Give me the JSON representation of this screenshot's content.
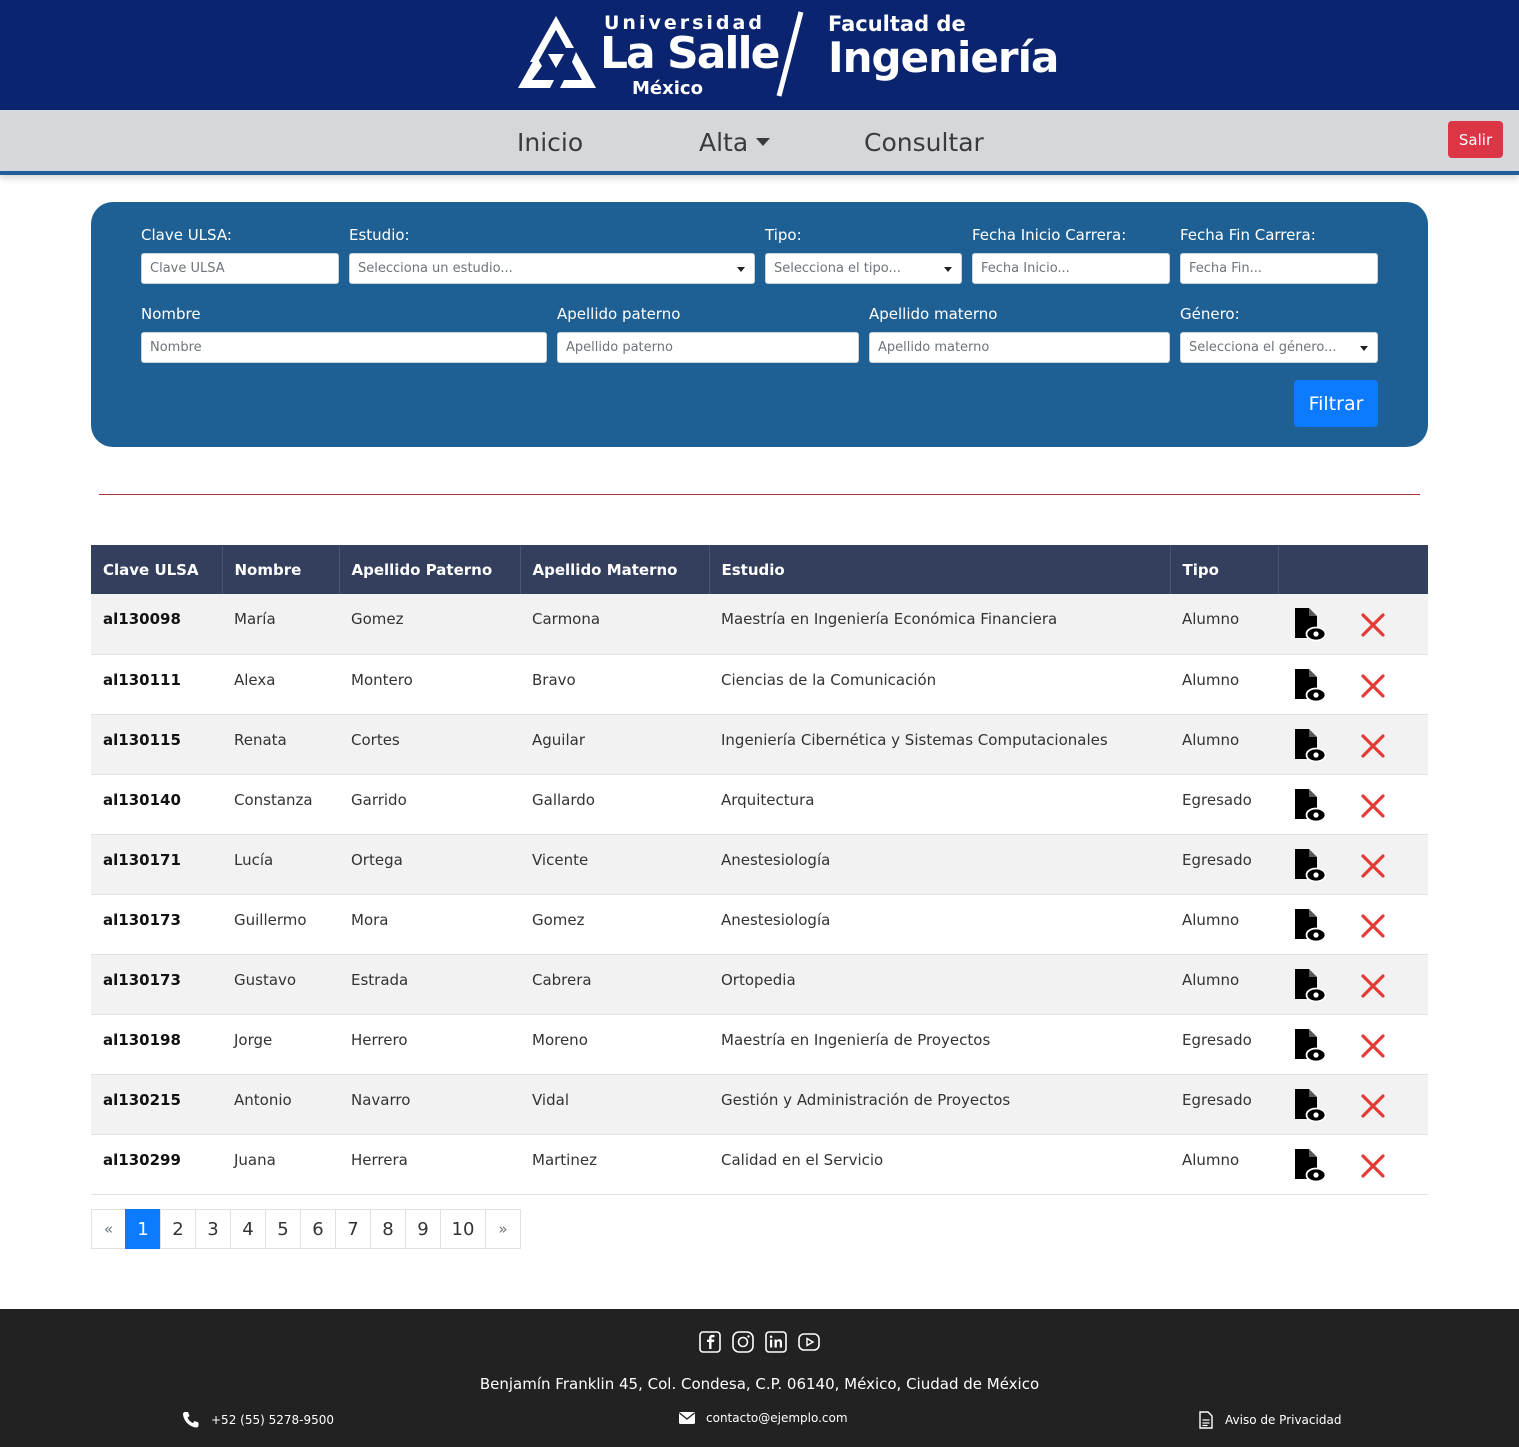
{
  "header": {
    "universidad": "Universidad",
    "lasalle": "La Salle",
    "mexico": "México",
    "facultad": "Facultad de",
    "ingenieria": "Ingeniería"
  },
  "nav": {
    "inicio": "Inicio",
    "alta": "Alta",
    "consultar": "Consultar",
    "salir": "Salir"
  },
  "filters": {
    "clave": {
      "label": "Clave ULSA:",
      "placeholder": "Clave ULSA"
    },
    "estudio": {
      "label": "Estudio:",
      "placeholder": "Selecciona un estudio..."
    },
    "tipo": {
      "label": "Tipo:",
      "placeholder": "Selecciona el tipo..."
    },
    "fecha_inicio": {
      "label": "Fecha Inicio Carrera:",
      "placeholder": "Fecha Inicio..."
    },
    "fecha_fin": {
      "label": "Fecha Fin Carrera:",
      "placeholder": "Fecha Fin..."
    },
    "nombre": {
      "label": "Nombre",
      "placeholder": "Nombre"
    },
    "apellido_paterno": {
      "label": "Apellido paterno",
      "placeholder": "Apellido paterno"
    },
    "apellido_materno": {
      "label": "Apellido materno",
      "placeholder": "Apellido materno"
    },
    "genero": {
      "label": "Género:",
      "placeholder": "Selecciona el género..."
    },
    "filtrar": "Filtrar"
  },
  "table": {
    "headers": [
      "Clave ULSA",
      "Nombre",
      "Apellido Paterno",
      "Apellido Materno",
      "Estudio",
      "Tipo",
      ""
    ],
    "rows": [
      {
        "clave": "al130098",
        "nombre": "María",
        "paterno": "Gomez",
        "materno": "Carmona",
        "estudio": "Maestría en Ingeniería Económica Financiera",
        "tipo": "Alumno"
      },
      {
        "clave": "al130111",
        "nombre": "Alexa",
        "paterno": "Montero",
        "materno": "Bravo",
        "estudio": "Ciencias de la Comunicación",
        "tipo": "Alumno"
      },
      {
        "clave": "al130115",
        "nombre": "Renata",
        "paterno": "Cortes",
        "materno": "Aguilar",
        "estudio": "Ingeniería Cibernética y Sistemas Computacionales",
        "tipo": "Alumno"
      },
      {
        "clave": "al130140",
        "nombre": "Constanza",
        "paterno": "Garrido",
        "materno": "Gallardo",
        "estudio": "Arquitectura",
        "tipo": "Egresado"
      },
      {
        "clave": "al130171",
        "nombre": "Lucía",
        "paterno": "Ortega",
        "materno": "Vicente",
        "estudio": "Anestesiología",
        "tipo": "Egresado"
      },
      {
        "clave": "al130173",
        "nombre": "Guillermo",
        "paterno": "Mora",
        "materno": "Gomez",
        "estudio": "Anestesiología",
        "tipo": "Alumno"
      },
      {
        "clave": "al130173",
        "nombre": "Gustavo",
        "paterno": "Estrada",
        "materno": "Cabrera",
        "estudio": "Ortopedia",
        "tipo": "Alumno"
      },
      {
        "clave": "al130198",
        "nombre": "Jorge",
        "paterno": "Herrero",
        "materno": "Moreno",
        "estudio": "Maestría en Ingeniería de Proyectos",
        "tipo": "Egresado"
      },
      {
        "clave": "al130215",
        "nombre": "Antonio",
        "paterno": "Navarro",
        "materno": "Vidal",
        "estudio": "Gestión y Administración de Proyectos",
        "tipo": "Egresado"
      },
      {
        "clave": "al130299",
        "nombre": "Juana",
        "paterno": "Herrera",
        "materno": "Martinez",
        "estudio": "Calidad en el Servicio",
        "tipo": "Alumno"
      }
    ]
  },
  "pagination": {
    "prev": "«",
    "next": "»",
    "pages": [
      "1",
      "2",
      "3",
      "4",
      "5",
      "6",
      "7",
      "8",
      "9",
      "10"
    ],
    "active": "1"
  },
  "footer": {
    "address": "Benjamín Franklin 45, Col. Condesa, C.P. 06140, México, Ciudad de México",
    "phone": "+52 (55) 5278-9500",
    "email": "contacto@ejemplo.com",
    "privacy": "Aviso de Privacidad",
    "socials": [
      "facebook-icon",
      "instagram-icon",
      "linkedin-icon",
      "youtube-icon"
    ]
  },
  "colors": {
    "brand": "#0a2470",
    "panel": "#1f6094",
    "primary": "#0d7bff",
    "danger": "#dc3545",
    "table_header": "#333f5d",
    "delete_icon": "#e53935"
  }
}
